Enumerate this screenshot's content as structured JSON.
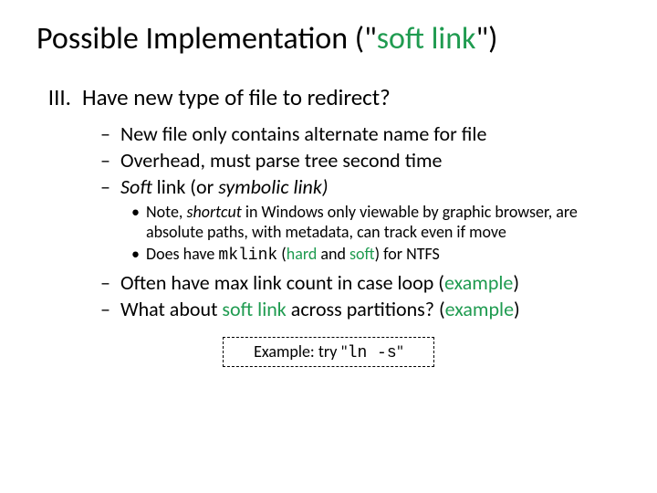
{
  "title": {
    "prefix": "Possible Implementation (\"",
    "accent": "soft link",
    "suffix": "\")"
  },
  "main": {
    "roman": "III.",
    "text": "Have new type of file to redirect?"
  },
  "dash": {
    "d1": "New file only contains alternate name for file",
    "d2": "Overhead, must parse tree second time",
    "d3a": "Soft",
    "d3b": " link (or ",
    "d3c": "symbolic link",
    "d3d": ")",
    "d4a": "Often have max link count in case loop (",
    "d4b": "example",
    "d4c": ")",
    "d5a": "What about ",
    "d5b": "soft link",
    "d5c": " across partitions? (",
    "d5d": "example",
    "d5e": ")"
  },
  "bullets": {
    "b1a": "Note, ",
    "b1b": "shortcut",
    "b1c": " in Windows only viewable by graphic browser, are absolute paths, with metadata, can track even if move",
    "b2a": "Does have ",
    "b2b": "mklink",
    "b2c": " (",
    "b2d": "hard",
    "b2e": " and ",
    "b2f": "soft",
    "b2g": ") for NTFS"
  },
  "example": {
    "pre": "Example: try \"",
    "cmd": "ln -s",
    "post": "\""
  }
}
